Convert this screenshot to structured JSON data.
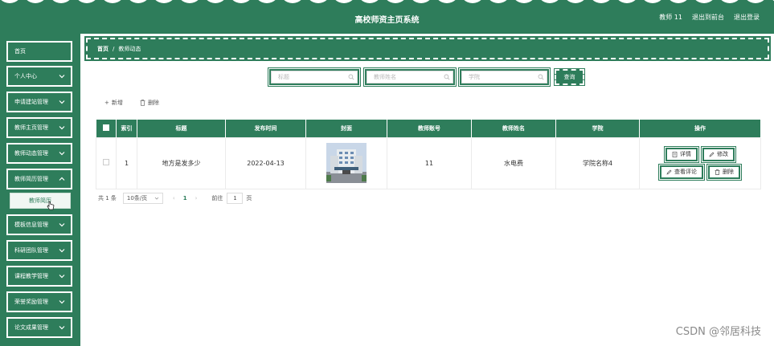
{
  "header": {
    "title": "高校师资主页系统",
    "user": "教师 11",
    "back_to_admin": "退出到前台",
    "logout": "退出登录"
  },
  "sidebar": {
    "items": [
      {
        "label": "首页"
      },
      {
        "label": "个人中心"
      },
      {
        "label": "申请建站管理"
      },
      {
        "label": "教师主页管理"
      },
      {
        "label": "教师动态管理"
      },
      {
        "label": "教师简历管理"
      },
      {
        "label": "模板信息管理"
      },
      {
        "label": "科研团队管理"
      },
      {
        "label": "课程教学管理"
      },
      {
        "label": "荣誉奖励管理"
      },
      {
        "label": "论文成果管理"
      }
    ],
    "submenu": {
      "label": "教师简历"
    }
  },
  "breadcrumb": {
    "home": "首页",
    "separator": "/",
    "current": "教师动态"
  },
  "search": {
    "title_placeholder": "标题",
    "teacher_name_placeholder": "教师姓名",
    "college_placeholder": "学院",
    "query_label": "查询"
  },
  "actions": {
    "add": "新增",
    "delete": "删除"
  },
  "table": {
    "headers": [
      "索引",
      "标题",
      "发布时间",
      "封面",
      "教师账号",
      "教师姓名",
      "学院",
      "操作"
    ],
    "rows": [
      {
        "index": "1",
        "title": "地方是发多少",
        "publish_time": "2022-04-13",
        "teacher_account": "11",
        "teacher_name": "水电费",
        "college": "学院名称4"
      }
    ],
    "ops": {
      "detail": "详情",
      "edit": "修改",
      "view_comments": "查看评论",
      "delete": "删除"
    }
  },
  "pagination": {
    "total": "共 1 条",
    "page_size": "10条/页",
    "current_page": "1",
    "goto_label": "前往",
    "goto_value": "1",
    "page_unit": "页"
  },
  "watermark": "CSDN @邻居科技",
  "colors": {
    "primary": "#2e7d5b",
    "white": "#ffffff"
  }
}
